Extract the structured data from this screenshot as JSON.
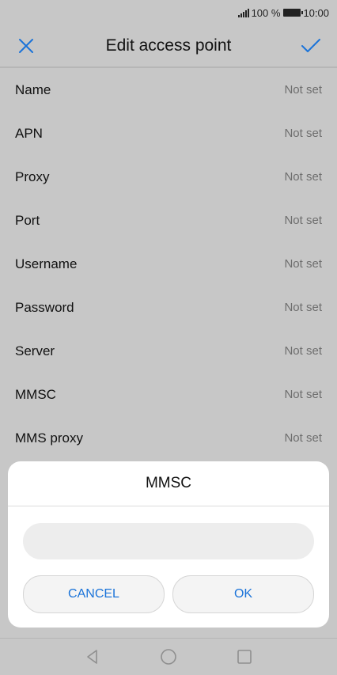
{
  "status_bar": {
    "battery": "100 %",
    "time": "10:00"
  },
  "header": {
    "title": "Edit access point"
  },
  "settings": [
    {
      "label": "Name",
      "value": "Not set"
    },
    {
      "label": "APN",
      "value": "Not set"
    },
    {
      "label": "Proxy",
      "value": "Not set"
    },
    {
      "label": "Port",
      "value": "Not set"
    },
    {
      "label": "Username",
      "value": "Not set"
    },
    {
      "label": "Password",
      "value": "Not set"
    },
    {
      "label": "Server",
      "value": "Not set"
    },
    {
      "label": "MMSC",
      "value": "Not set"
    },
    {
      "label": "MMS proxy",
      "value": "Not set"
    }
  ],
  "dialog": {
    "title": "MMSC",
    "input_value": "",
    "cancel_label": "CANCEL",
    "ok_label": "OK"
  },
  "colors": {
    "accent": "#1a73d9",
    "overlay": "#c7c7c7"
  },
  "icons": {
    "close": "close-icon",
    "confirm": "checkmark-icon",
    "back": "back-triangle-icon",
    "home": "home-circle-icon",
    "recents": "recents-square-icon"
  }
}
